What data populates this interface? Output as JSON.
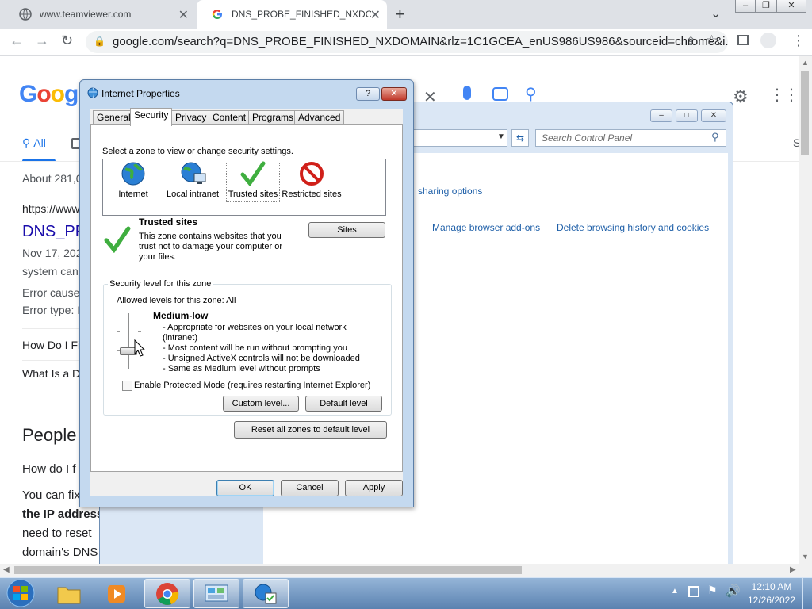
{
  "browser": {
    "tabs": [
      {
        "title": "www.teamviewer.com",
        "active": false
      },
      {
        "title": "DNS_PROBE_FINISHED_NXDOMAIN",
        "active": true
      }
    ],
    "url": "google.com/search?q=DNS_PROBE_FINISHED_NXDOMAIN&rlz=1C1GCEA_enUS986US986&sourceid=chrome&i..."
  },
  "google": {
    "logo": "Google",
    "tab_all": "All",
    "results_count": "About 281,0",
    "result_url": "https://www",
    "result_title": "DNS_PF",
    "result_date": "Nov 17, 202",
    "result_snippet": "system can",
    "error_cause": "Error cause",
    "error_type": "Error type: I",
    "faq1": "How Do I Fi",
    "faq2": "What Is a D",
    "people_heading": "People",
    "paa1": "How do I f",
    "paa2": "You can fix",
    "paa3": "the IP address",
    "paa4": "need to reset",
    "paa5": "domain's DNS",
    "right_cut": "S"
  },
  "control_panel": {
    "search_placeholder": "Search Control Panel",
    "link_sharing": "sharing options",
    "link_addons": "Manage browser add-ons",
    "link_delete": "Delete browsing history and cookies"
  },
  "dialog": {
    "title": "Internet Properties",
    "tabs": [
      "General",
      "Security",
      "Privacy",
      "Content",
      "Programs",
      "Advanced"
    ],
    "zone_prompt": "Select a zone to view or change security settings.",
    "zones": [
      {
        "label": "Internet"
      },
      {
        "label": "Local intranet"
      },
      {
        "label": "Trusted sites"
      },
      {
        "label": "Restricted sites"
      }
    ],
    "selected_zone_title": "Trusted sites",
    "zone_desc_1": "This zone contains websites that you",
    "zone_desc_2": "trust not to damage your computer or",
    "zone_desc_3": "your files.",
    "sites_button": "Sites",
    "security_group_label": "Security level for this zone",
    "allowed_levels": "Allowed levels for this zone: All",
    "level_name": "Medium-low",
    "level_points": [
      "- Appropriate for websites on your local network",
      "(intranet)",
      "- Most content will be run without prompting you",
      "- Unsigned ActiveX controls will not be downloaded",
      "- Same as Medium level without prompts"
    ],
    "protected_mode": "Enable Protected Mode (requires restarting Internet Explorer)",
    "protected_mode_checked": false,
    "custom_level": "Custom level...",
    "default_level": "Default level",
    "reset_all": "Reset all zones to default level",
    "ok": "OK",
    "cancel": "Cancel",
    "apply": "Apply"
  },
  "taskbar": {
    "time": "12:10 AM",
    "date": "12/26/2022"
  }
}
